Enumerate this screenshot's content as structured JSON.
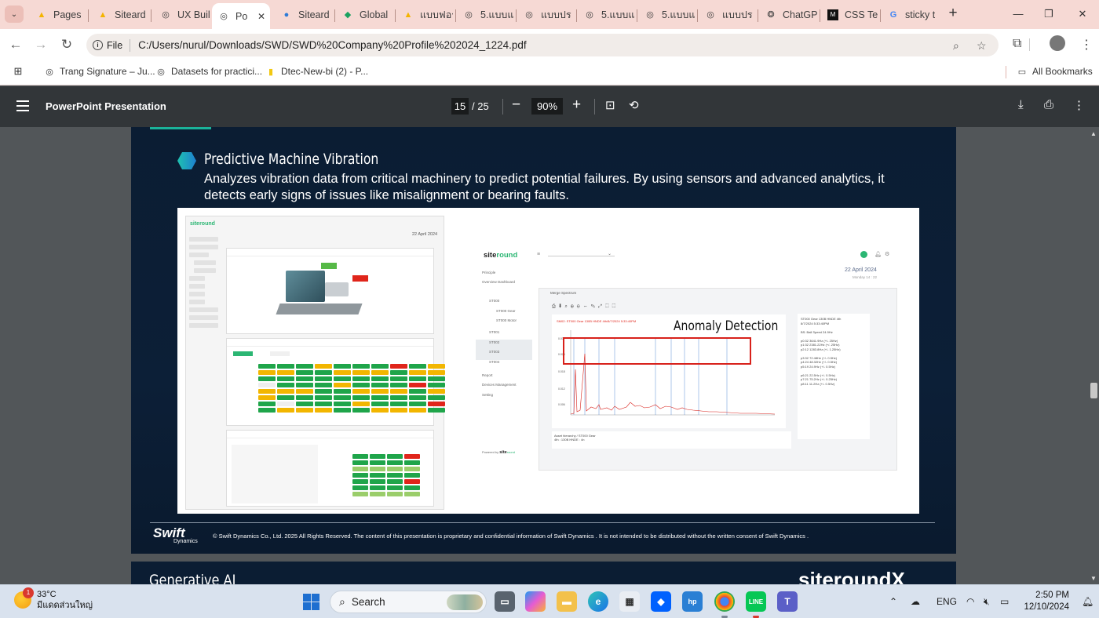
{
  "browser": {
    "tabs": [
      {
        "title": "Pages",
        "icon": "drive-warning-icon",
        "active": false
      },
      {
        "title": "Siteard",
        "icon": "drive-warning-icon",
        "active": false
      },
      {
        "title": "UX Buil",
        "icon": "globe-icon",
        "active": false
      },
      {
        "title": "Po",
        "icon": "globe-icon",
        "active": true
      },
      {
        "title": "Siteard",
        "icon": "siteard-icon",
        "active": false
      },
      {
        "title": "Global",
        "icon": "sheets-icon",
        "active": false
      },
      {
        "title": "แบบฟอร",
        "icon": "google-drive-icon",
        "active": false
      },
      {
        "title": "5.แบบแ",
        "icon": "globe-icon",
        "active": false
      },
      {
        "title": "แบบปร",
        "icon": "globe-icon",
        "active": false
      },
      {
        "title": "5.แบบแ",
        "icon": "globe-icon",
        "active": false
      },
      {
        "title": "5.แบบแ",
        "icon": "globe-icon",
        "active": false
      },
      {
        "title": "แบบปร",
        "icon": "globe-icon",
        "active": false
      },
      {
        "title": "ChatGP",
        "icon": "chatgpt-icon",
        "active": false
      },
      {
        "title": "CSS Tex",
        "icon": "mdn-icon",
        "active": false
      },
      {
        "title": "sticky t",
        "icon": "google-icon",
        "active": false
      }
    ],
    "url_scheme_label": "File",
    "url": "C:/Users/nurul/Downloads/SWD/SWD%20Company%20Profile%202024_1224.pdf",
    "bookmarks": [
      {
        "label": "Trang Signature – Ju..."
      },
      {
        "label": "Datasets for practici..."
      },
      {
        "label": "Dtec-New-bi (2) - P..."
      }
    ],
    "all_bookmarks_label": "All Bookmarks"
  },
  "pdf_viewer": {
    "doc_title": "PowerPoint Presentation",
    "current_page": "15",
    "total_pages": "/ 25",
    "zoom": "90%"
  },
  "slide": {
    "section_title": "Predictive Machine Vibration",
    "description": "Analyzes vibration data from critical machinery to predict potential failures. By using sensors and advanced analytics, it detects early signs of issues like misalignment or bearing faults.",
    "footer_logo": "Swift",
    "footer_logo_sub": "Dynamics",
    "footer_text": "© Swift Dynamics Co., Ltd. 2025 All Rights Reserved. The content of this presentation is proprietary and confidential information of Swift Dynamics . It is not intended to be distributed without the written consent of Swift Dynamics .",
    "next_slide_title": "Generative AI",
    "next_slide_brand": "siteroundX"
  },
  "dashboard_right": {
    "brand_a": "site",
    "brand_b": "round",
    "date": "22 April 2024",
    "date_sub": "Monday 14 : 22",
    "sidebar": [
      "Principle",
      "Overview Dashboard",
      "ST000",
      "ST000 Gear",
      "ST000 Motor",
      "ST001",
      "ST002",
      "ST003",
      "ST004",
      "Report",
      "Devices Management",
      "Setting"
    ],
    "panel_title": "Merge Spectrum",
    "chart_title": "SM02: ST000 Gear 130B HNDE 4th/8/7/2024 5:33:40PM",
    "info_lines": [
      "ST000 Gear 130B HNDE 4th",
      "8/7/2024 5:33:40PM",
      "",
      "BS: Ball Speed 24.9Hz",
      "",
      "p0:32 3641.9Hz (+/- 25Hz)",
      "p1:32 2381.22Hz (+/- 25Hz)",
      "p2:12 1283.8Hz (+/- 1.25Hz)",
      "",
      "p3:32 72.48Hz (+/- 0.5Hz)",
      "p4:24 48.32Hz (+/- 0.5Hz)",
      "p5:19 24.9Hz (+/- 0.5Hz)",
      "",
      "p6:21 22.5Hz (+/- 0.5Hz)",
      "p7:21 75.2Hz (+/- 0.25Hz)",
      "p8:11 11.2Hz (+/- 0.5Hz)"
    ],
    "asset_hierarchy": "Asset hierarchy / ST000 Gear",
    "asset_sub": "4th : 130B HNDE : 4n",
    "powered_by": "Powered by",
    "anomaly_label": "Anomaly Detection"
  },
  "dashboard_left": {
    "brand_a": "site",
    "brand_b": "round",
    "date": "22 April 2024"
  },
  "taskbar": {
    "temp": "33°C",
    "weather": "มีแดดส่วนใหญ่",
    "badge": "1",
    "search_label": "Search",
    "lang": "ENG",
    "time": "2:50 PM",
    "date": "12/10/2024"
  }
}
